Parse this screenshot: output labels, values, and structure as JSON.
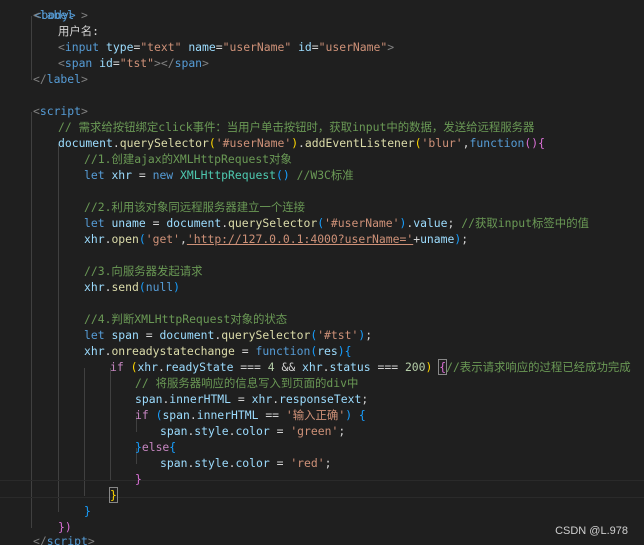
{
  "code": {
    "l0_partial": "<body>",
    "l1_label_open": "label",
    "l2_text": "用户名:",
    "l3_input_tag": "input",
    "l3_type_attr": "type",
    "l3_type_val": "\"text\"",
    "l3_name_attr": "name",
    "l3_name_val": "\"userName\"",
    "l3_id_attr": "id",
    "l3_id_val": "\"userName\"",
    "l4_span_tag": "span",
    "l4_id_attr": "id",
    "l4_id_val": "\"tst\"",
    "l4_span_close": "span",
    "l5_label_close": "label",
    "l7_script_open": "script",
    "l8_comment": "// 需求给按钮绑定click事件：当用户单击按钮时，获取input中的数据，发送给远程服务器",
    "l9_doc": "document",
    "l9_qs": "querySelector",
    "l9_sel": "'#userName'",
    "l9_ael": "addEventListener",
    "l9_blur": "'blur'",
    "l9_function": "function",
    "l10_comment": "//1.创建ajax的XMLHttpRequest对象",
    "l11_let": "let",
    "l11_xhr": "xhr",
    "l11_new": "new",
    "l11_xhrclass": "XMLHttpRequest",
    "l11_comment": "//W3C标准",
    "l13_comment": "//2.利用该对象同远程服务器建立一个连接",
    "l14_let": "let",
    "l14_uname": "uname",
    "l14_doc": "document",
    "l14_qs": "querySelector",
    "l14_sel": "'#userName'",
    "l14_value": "value",
    "l14_comment": "//获取input标签中的值",
    "l15_xhr": "xhr",
    "l15_open": "open",
    "l15_get": "'get'",
    "l15_url": "'http://127.0.0.1:4000?userName='",
    "l15_uname": "uname",
    "l17_comment": "//3.向服务器发起请求",
    "l18_xhr": "xhr",
    "l18_send": "send",
    "l18_null": "null",
    "l20_comment": "//4.判断XMLHttpRequest对象的状态",
    "l21_let": "let",
    "l21_span": "span",
    "l21_doc": "document",
    "l21_qs": "querySelector",
    "l21_sel": "'#tst'",
    "l22_xhr": "xhr",
    "l22_orsc": "onreadystatechange",
    "l22_function": "function",
    "l22_res": "res",
    "l23_if": "if",
    "l23_xhr1": "xhr",
    "l23_rs": "readyState",
    "l23_4": "4",
    "l23_xhr2": "xhr",
    "l23_status": "status",
    "l23_200": "200",
    "l23_comment": "//表示请求响应的过程已经成功完成",
    "l24_comment": "// 将服务器响应的信息写入到页面的div中",
    "l25_span": "span",
    "l25_ih": "innerHTML",
    "l25_xhr": "xhr",
    "l25_rt": "responseText",
    "l26_if": "if",
    "l26_span": "span",
    "l26_ih": "innerHTML",
    "l26_str": "'输入正确'",
    "l27_span": "span",
    "l27_style": "style",
    "l27_color": "color",
    "l27_green": "'green'",
    "l28_else": "else",
    "l29_span": "span",
    "l29_style": "style",
    "l29_color": "color",
    "l29_red": "'red'",
    "l34_script_close": "script"
  },
  "watermark": "CSDN @L.978",
  "colors": {
    "background": "#1f1f1f",
    "tag": "#569cd6",
    "attribute": "#9cdcfe",
    "string": "#ce9178",
    "comment": "#6a9955",
    "function": "#dcdcaa",
    "class": "#4ec9b0",
    "number": "#b5cea8",
    "control": "#c586c0"
  }
}
